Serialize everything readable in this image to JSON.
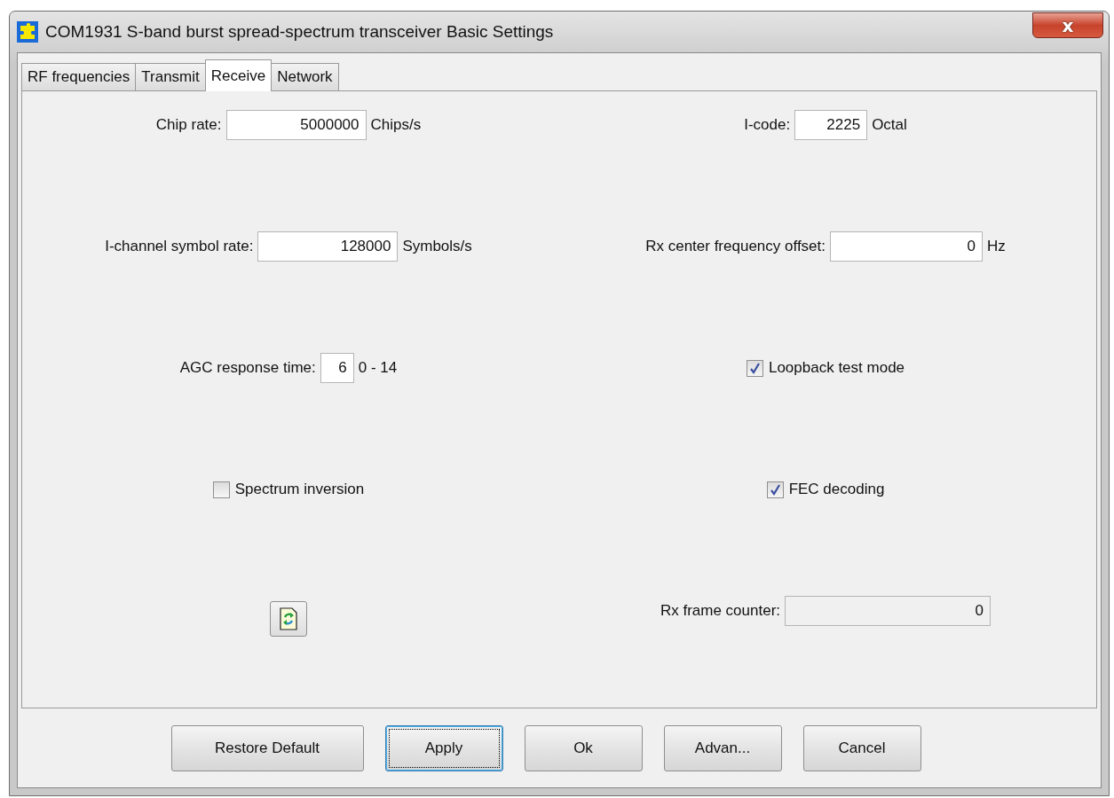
{
  "window": {
    "title": "COM1931 S-band burst spread-spectrum transceiver Basic Settings",
    "close": "x"
  },
  "tabs": [
    {
      "label": "RF frequencies",
      "selected": false
    },
    {
      "label": "Transmit",
      "selected": false
    },
    {
      "label": "Receive",
      "selected": true
    },
    {
      "label": "Network",
      "selected": false
    }
  ],
  "settings": [
    {
      "kind": "field",
      "label": "Chip rate:",
      "value": "5000000",
      "unit": "Chips/s"
    },
    {
      "kind": "field",
      "label": "I-code:",
      "value": "2225",
      "unit": "Octal"
    },
    {
      "kind": "field",
      "label": "I-channel symbol rate:",
      "value": "128000",
      "unit": "Symbols/s"
    },
    {
      "kind": "field",
      "label": "Rx center frequency offset:",
      "value": "0",
      "unit": "Hz"
    },
    {
      "kind": "field",
      "label": "AGC response time:",
      "value": "6",
      "unit": "0 - 14"
    },
    {
      "kind": "checkbox",
      "label": "Loopback test mode",
      "checked": true
    },
    {
      "kind": "checkbox",
      "label": "Spectrum inversion",
      "checked": false
    },
    {
      "kind": "checkbox",
      "label": "FEC decoding",
      "checked": true
    },
    {
      "kind": "refresh"
    },
    {
      "kind": "readonly",
      "label": "Rx frame counter:",
      "value": "0"
    }
  ],
  "buttons": [
    {
      "label": "Restore Default",
      "default": false
    },
    {
      "label": "Apply",
      "default": true
    },
    {
      "label": "Ok",
      "default": false
    },
    {
      "label": "Advan...",
      "default": false
    },
    {
      "label": "Cancel",
      "default": false
    }
  ]
}
